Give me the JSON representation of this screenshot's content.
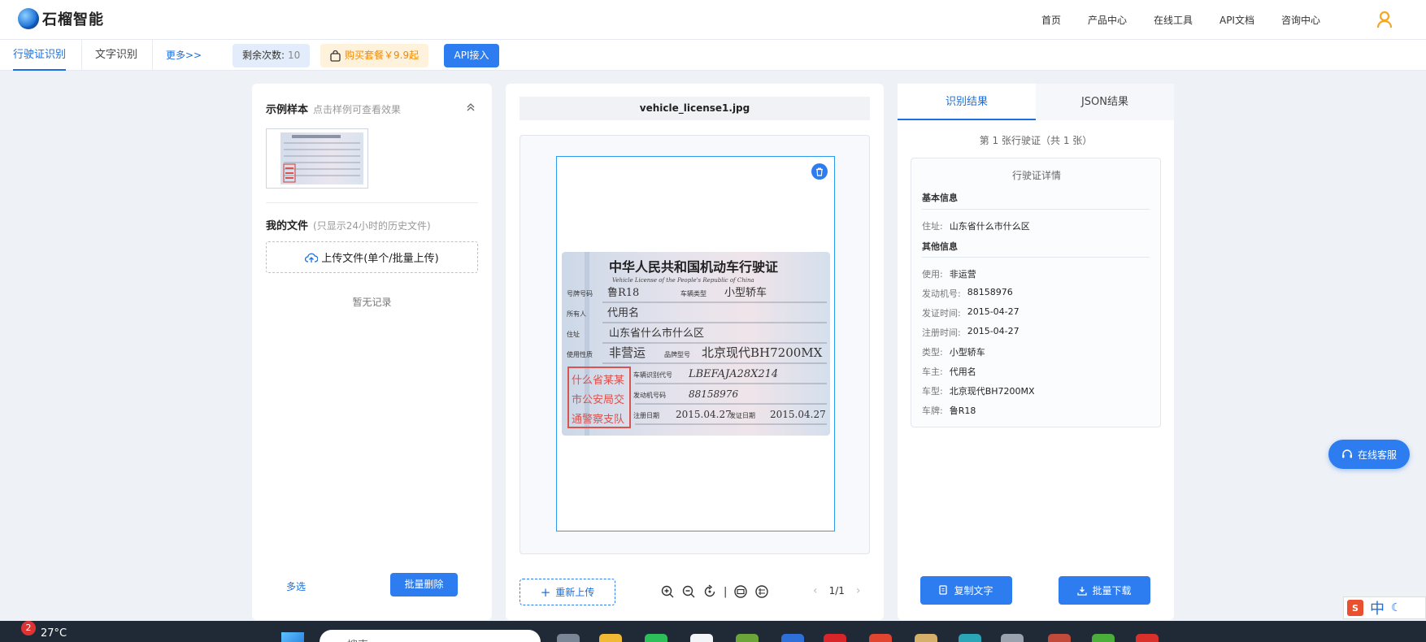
{
  "app": {
    "name": "石榴智能"
  },
  "nav": {
    "items": [
      "首页",
      "产品中心",
      "在线工具",
      "API文档",
      "咨询中心"
    ]
  },
  "subbar": {
    "tabs": [
      "行驶证识别",
      "文字识别"
    ],
    "more": "更多>>",
    "remain_label": "剩余次数:",
    "remain_value": "10",
    "buy_label": "购买套餐￥9.9起",
    "api_label": "API接入"
  },
  "left": {
    "sample_title": "示例样本",
    "sample_hint": "点击样例可查看效果",
    "files_title": "我的文件",
    "files_hint": "(只显示24小时的历史文件)",
    "upload_label": "上传文件(单个/批量上传)",
    "empty_text": "暂无记录",
    "multi_select": "多选",
    "batch_delete": "批量删除"
  },
  "middle": {
    "filename": "vehicle_license1.jpg",
    "reupload": "重新上传",
    "page": "1/1",
    "tool_separator": "|"
  },
  "license_image": {
    "title_cn": "中华人民共和国机动车行驶证",
    "title_en": "Vehicle License of the People's Republic of China",
    "plate_label": "号牌号码",
    "plate": "鲁R18",
    "vehicle_type_label": "车辆类型",
    "vehicle_type": "小型轿车",
    "owner_label": "所有人",
    "owner": "代用名",
    "address_label": "住址",
    "address": "山东省什么市什么区",
    "use_label": "使用性质",
    "use": "非营运",
    "model_label": "品牌型号",
    "model": "北京现代BH7200MX",
    "vin_label": "车辆识别代号",
    "vin": "LBEFAJA28X214",
    "engine_label": "发动机号码",
    "engine": "88158976",
    "reg_label": "注册日期",
    "reg_date": "2015.04.27",
    "issue_label": "发证日期",
    "issue_date": "2015.04.27",
    "stamp": [
      "什么省某某",
      "市公安局交",
      "通警察支队"
    ]
  },
  "right": {
    "tabs": [
      "识别结果",
      "JSON结果"
    ],
    "count_line": "第 1 张行驶证（共 1 张）",
    "card_title": "行驶证详情",
    "groups": [
      {
        "title": "基本信息",
        "rows": [
          {
            "k": "住址:",
            "v": "山东省什么市什么区"
          }
        ]
      },
      {
        "title": "其他信息",
        "rows": [
          {
            "k": "使用:",
            "v": "非运营"
          },
          {
            "k": "发动机号:",
            "v": "88158976"
          },
          {
            "k": "发证时间:",
            "v": "2015-04-27"
          },
          {
            "k": "注册时间:",
            "v": "2015-04-27"
          },
          {
            "k": "类型:",
            "v": "小型轿车"
          },
          {
            "k": "车主:",
            "v": "代用名"
          },
          {
            "k": "车型:",
            "v": "北京现代BH7200MX"
          },
          {
            "k": "车牌:",
            "v": "鲁R18"
          }
        ]
      }
    ],
    "copy_label": "复制文字",
    "download_label": "批量下载"
  },
  "float": {
    "customer_service": "在线客服"
  },
  "ime": {
    "mode": "中"
  },
  "taskbar": {
    "badge": "2",
    "temp": "27°C",
    "search_placeholder": "搜索"
  },
  "colors": {
    "accent": "#2d7cf0",
    "buy": "#f08a00",
    "user": "#f5a623"
  },
  "icons": [
    "logo-icon",
    "user-icon",
    "bag-icon",
    "chevron-up-icon",
    "cloud-upload-icon",
    "trash-icon",
    "plus-icon",
    "zoom-in-icon",
    "zoom-out-icon",
    "rotate-icon",
    "fit-icon",
    "original-size-icon",
    "chevron-left-icon",
    "chevron-right-icon",
    "copy-icon",
    "download-icon",
    "headset-icon"
  ]
}
